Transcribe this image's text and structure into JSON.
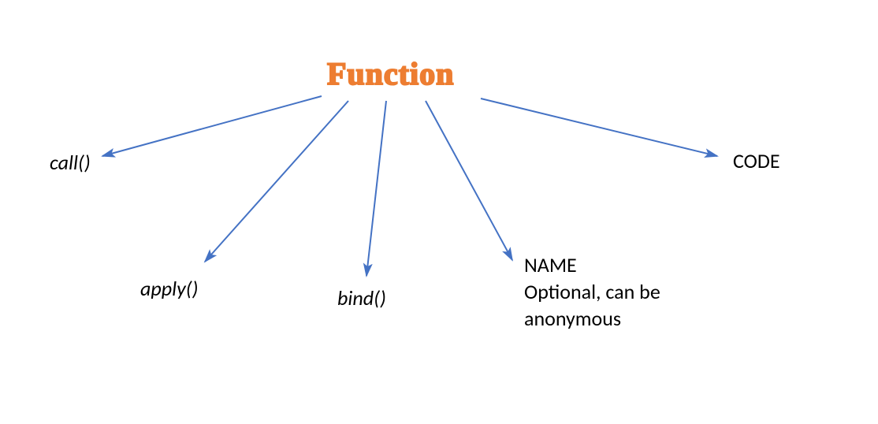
{
  "diagram": {
    "title": "Function",
    "nodes": {
      "call": "call()",
      "apply": "apply()",
      "bind": "bind()",
      "name_line1": "NAME",
      "name_line2": "Optional, can be",
      "name_line3": "anonymous",
      "code": "CODE"
    },
    "colors": {
      "accent": "#ED7D31",
      "arrow": "#4472C4",
      "text": "#000000"
    }
  }
}
